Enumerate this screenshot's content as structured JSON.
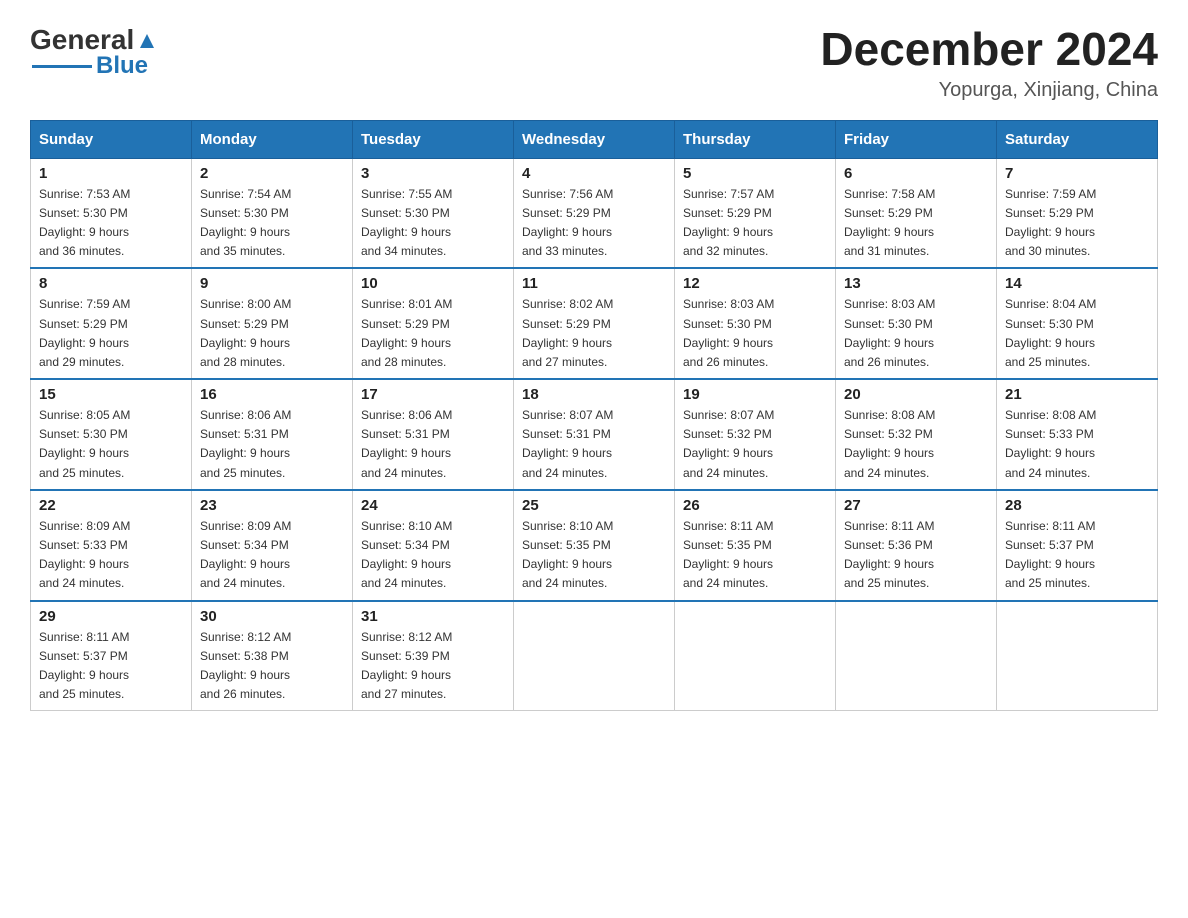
{
  "header": {
    "logo_text_general": "General",
    "logo_text_blue": "Blue",
    "month_year": "December 2024",
    "location": "Yopurga, Xinjiang, China"
  },
  "days_of_week": [
    "Sunday",
    "Monday",
    "Tuesday",
    "Wednesday",
    "Thursday",
    "Friday",
    "Saturday"
  ],
  "weeks": [
    [
      {
        "day": "1",
        "sunrise": "7:53 AM",
        "sunset": "5:30 PM",
        "daylight": "9 hours and 36 minutes."
      },
      {
        "day": "2",
        "sunrise": "7:54 AM",
        "sunset": "5:30 PM",
        "daylight": "9 hours and 35 minutes."
      },
      {
        "day": "3",
        "sunrise": "7:55 AM",
        "sunset": "5:30 PM",
        "daylight": "9 hours and 34 minutes."
      },
      {
        "day": "4",
        "sunrise": "7:56 AM",
        "sunset": "5:29 PM",
        "daylight": "9 hours and 33 minutes."
      },
      {
        "day": "5",
        "sunrise": "7:57 AM",
        "sunset": "5:29 PM",
        "daylight": "9 hours and 32 minutes."
      },
      {
        "day": "6",
        "sunrise": "7:58 AM",
        "sunset": "5:29 PM",
        "daylight": "9 hours and 31 minutes."
      },
      {
        "day": "7",
        "sunrise": "7:59 AM",
        "sunset": "5:29 PM",
        "daylight": "9 hours and 30 minutes."
      }
    ],
    [
      {
        "day": "8",
        "sunrise": "7:59 AM",
        "sunset": "5:29 PM",
        "daylight": "9 hours and 29 minutes."
      },
      {
        "day": "9",
        "sunrise": "8:00 AM",
        "sunset": "5:29 PM",
        "daylight": "9 hours and 28 minutes."
      },
      {
        "day": "10",
        "sunrise": "8:01 AM",
        "sunset": "5:29 PM",
        "daylight": "9 hours and 28 minutes."
      },
      {
        "day": "11",
        "sunrise": "8:02 AM",
        "sunset": "5:29 PM",
        "daylight": "9 hours and 27 minutes."
      },
      {
        "day": "12",
        "sunrise": "8:03 AM",
        "sunset": "5:30 PM",
        "daylight": "9 hours and 26 minutes."
      },
      {
        "day": "13",
        "sunrise": "8:03 AM",
        "sunset": "5:30 PM",
        "daylight": "9 hours and 26 minutes."
      },
      {
        "day": "14",
        "sunrise": "8:04 AM",
        "sunset": "5:30 PM",
        "daylight": "9 hours and 25 minutes."
      }
    ],
    [
      {
        "day": "15",
        "sunrise": "8:05 AM",
        "sunset": "5:30 PM",
        "daylight": "9 hours and 25 minutes."
      },
      {
        "day": "16",
        "sunrise": "8:06 AM",
        "sunset": "5:31 PM",
        "daylight": "9 hours and 25 minutes."
      },
      {
        "day": "17",
        "sunrise": "8:06 AM",
        "sunset": "5:31 PM",
        "daylight": "9 hours and 24 minutes."
      },
      {
        "day": "18",
        "sunrise": "8:07 AM",
        "sunset": "5:31 PM",
        "daylight": "9 hours and 24 minutes."
      },
      {
        "day": "19",
        "sunrise": "8:07 AM",
        "sunset": "5:32 PM",
        "daylight": "9 hours and 24 minutes."
      },
      {
        "day": "20",
        "sunrise": "8:08 AM",
        "sunset": "5:32 PM",
        "daylight": "9 hours and 24 minutes."
      },
      {
        "day": "21",
        "sunrise": "8:08 AM",
        "sunset": "5:33 PM",
        "daylight": "9 hours and 24 minutes."
      }
    ],
    [
      {
        "day": "22",
        "sunrise": "8:09 AM",
        "sunset": "5:33 PM",
        "daylight": "9 hours and 24 minutes."
      },
      {
        "day": "23",
        "sunrise": "8:09 AM",
        "sunset": "5:34 PM",
        "daylight": "9 hours and 24 minutes."
      },
      {
        "day": "24",
        "sunrise": "8:10 AM",
        "sunset": "5:34 PM",
        "daylight": "9 hours and 24 minutes."
      },
      {
        "day": "25",
        "sunrise": "8:10 AM",
        "sunset": "5:35 PM",
        "daylight": "9 hours and 24 minutes."
      },
      {
        "day": "26",
        "sunrise": "8:11 AM",
        "sunset": "5:35 PM",
        "daylight": "9 hours and 24 minutes."
      },
      {
        "day": "27",
        "sunrise": "8:11 AM",
        "sunset": "5:36 PM",
        "daylight": "9 hours and 25 minutes."
      },
      {
        "day": "28",
        "sunrise": "8:11 AM",
        "sunset": "5:37 PM",
        "daylight": "9 hours and 25 minutes."
      }
    ],
    [
      {
        "day": "29",
        "sunrise": "8:11 AM",
        "sunset": "5:37 PM",
        "daylight": "9 hours and 25 minutes."
      },
      {
        "day": "30",
        "sunrise": "8:12 AM",
        "sunset": "5:38 PM",
        "daylight": "9 hours and 26 minutes."
      },
      {
        "day": "31",
        "sunrise": "8:12 AM",
        "sunset": "5:39 PM",
        "daylight": "9 hours and 27 minutes."
      },
      null,
      null,
      null,
      null
    ]
  ],
  "labels": {
    "sunrise_prefix": "Sunrise: ",
    "sunset_prefix": "Sunset: ",
    "daylight_prefix": "Daylight: "
  }
}
